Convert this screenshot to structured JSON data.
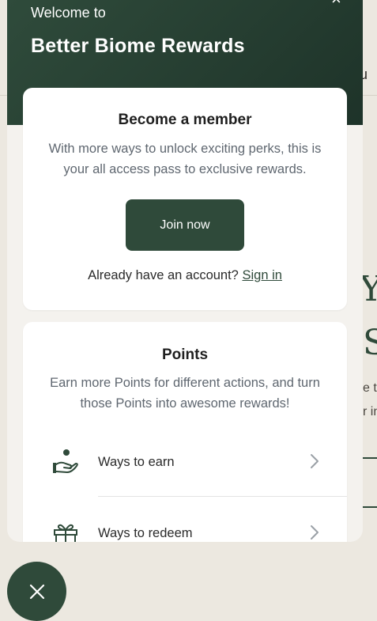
{
  "background": {
    "partial_nav_text": "lu",
    "partial_heading_1": "Y",
    "partial_heading_2": "S",
    "partial_text_1": "e t",
    "partial_text_2": "r in"
  },
  "panel": {
    "welcome_text": "Welcome to",
    "brand_name": "Better Biome Rewards",
    "close_symbol": "×"
  },
  "member_card": {
    "title": "Become a member",
    "description": "With more ways to unlock exciting perks, this is your all access pass to exclusive rewards.",
    "join_button": "Join now",
    "signin_prompt": "Already have an account?",
    "signin_link": "Sign in"
  },
  "points_card": {
    "title": "Points",
    "description": "Earn more Points for different actions, and turn those Points into awesome rewards!",
    "items": [
      {
        "label": "Ways to earn",
        "icon": "hand-coin-icon"
      },
      {
        "label": "Ways to redeem",
        "icon": "gift-icon"
      }
    ]
  },
  "fab": {
    "icon": "close-icon"
  },
  "colors": {
    "brand_green": "#2f4a3a",
    "background": "#ece8e0"
  }
}
